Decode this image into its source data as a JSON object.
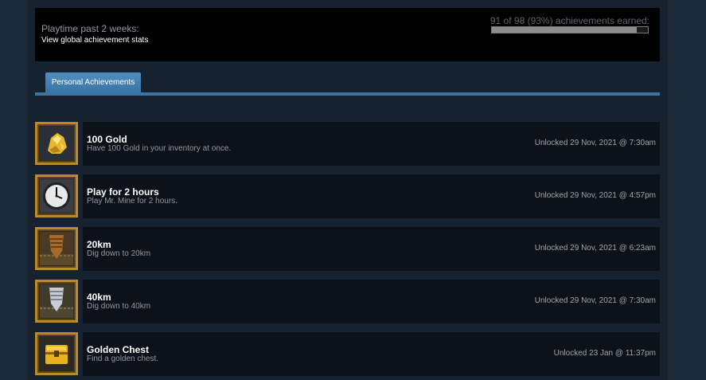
{
  "summary": {
    "playtime_label": "Playtime past 2 weeks:",
    "global_stats_link": "View global achievement stats",
    "progress_text": "91 of 98 (93%) achievements earned:",
    "progress_fraction": 0.93
  },
  "tabs": [
    {
      "label": "Personal Achievements",
      "active": true
    }
  ],
  "achievements": [
    {
      "title": "100 Gold",
      "description": "Have 100 Gold in your inventory at once.",
      "unlocked": "Unlocked 29 Nov, 2021 @ 7:30am",
      "icon": "gold-nugget-icon"
    },
    {
      "title": "Play for 2 hours",
      "description": "Play Mr. Mine for 2 hours.",
      "unlocked": "Unlocked 29 Nov, 2021 @ 4:57pm",
      "icon": "clock-icon"
    },
    {
      "title": "20km",
      "description": "Dig down to 20km",
      "unlocked": "Unlocked 29 Nov, 2021 @ 6:23am",
      "icon": "drill-bronze-icon"
    },
    {
      "title": "40km",
      "description": "Dig down to 40km",
      "unlocked": "Unlocked 29 Nov, 2021 @ 7:30am",
      "icon": "drill-silver-icon"
    },
    {
      "title": "Golden Chest",
      "description": "Find a golden chest.",
      "unlocked": "Unlocked 23 Jan @ 11:37pm",
      "icon": "golden-chest-icon"
    }
  ]
}
